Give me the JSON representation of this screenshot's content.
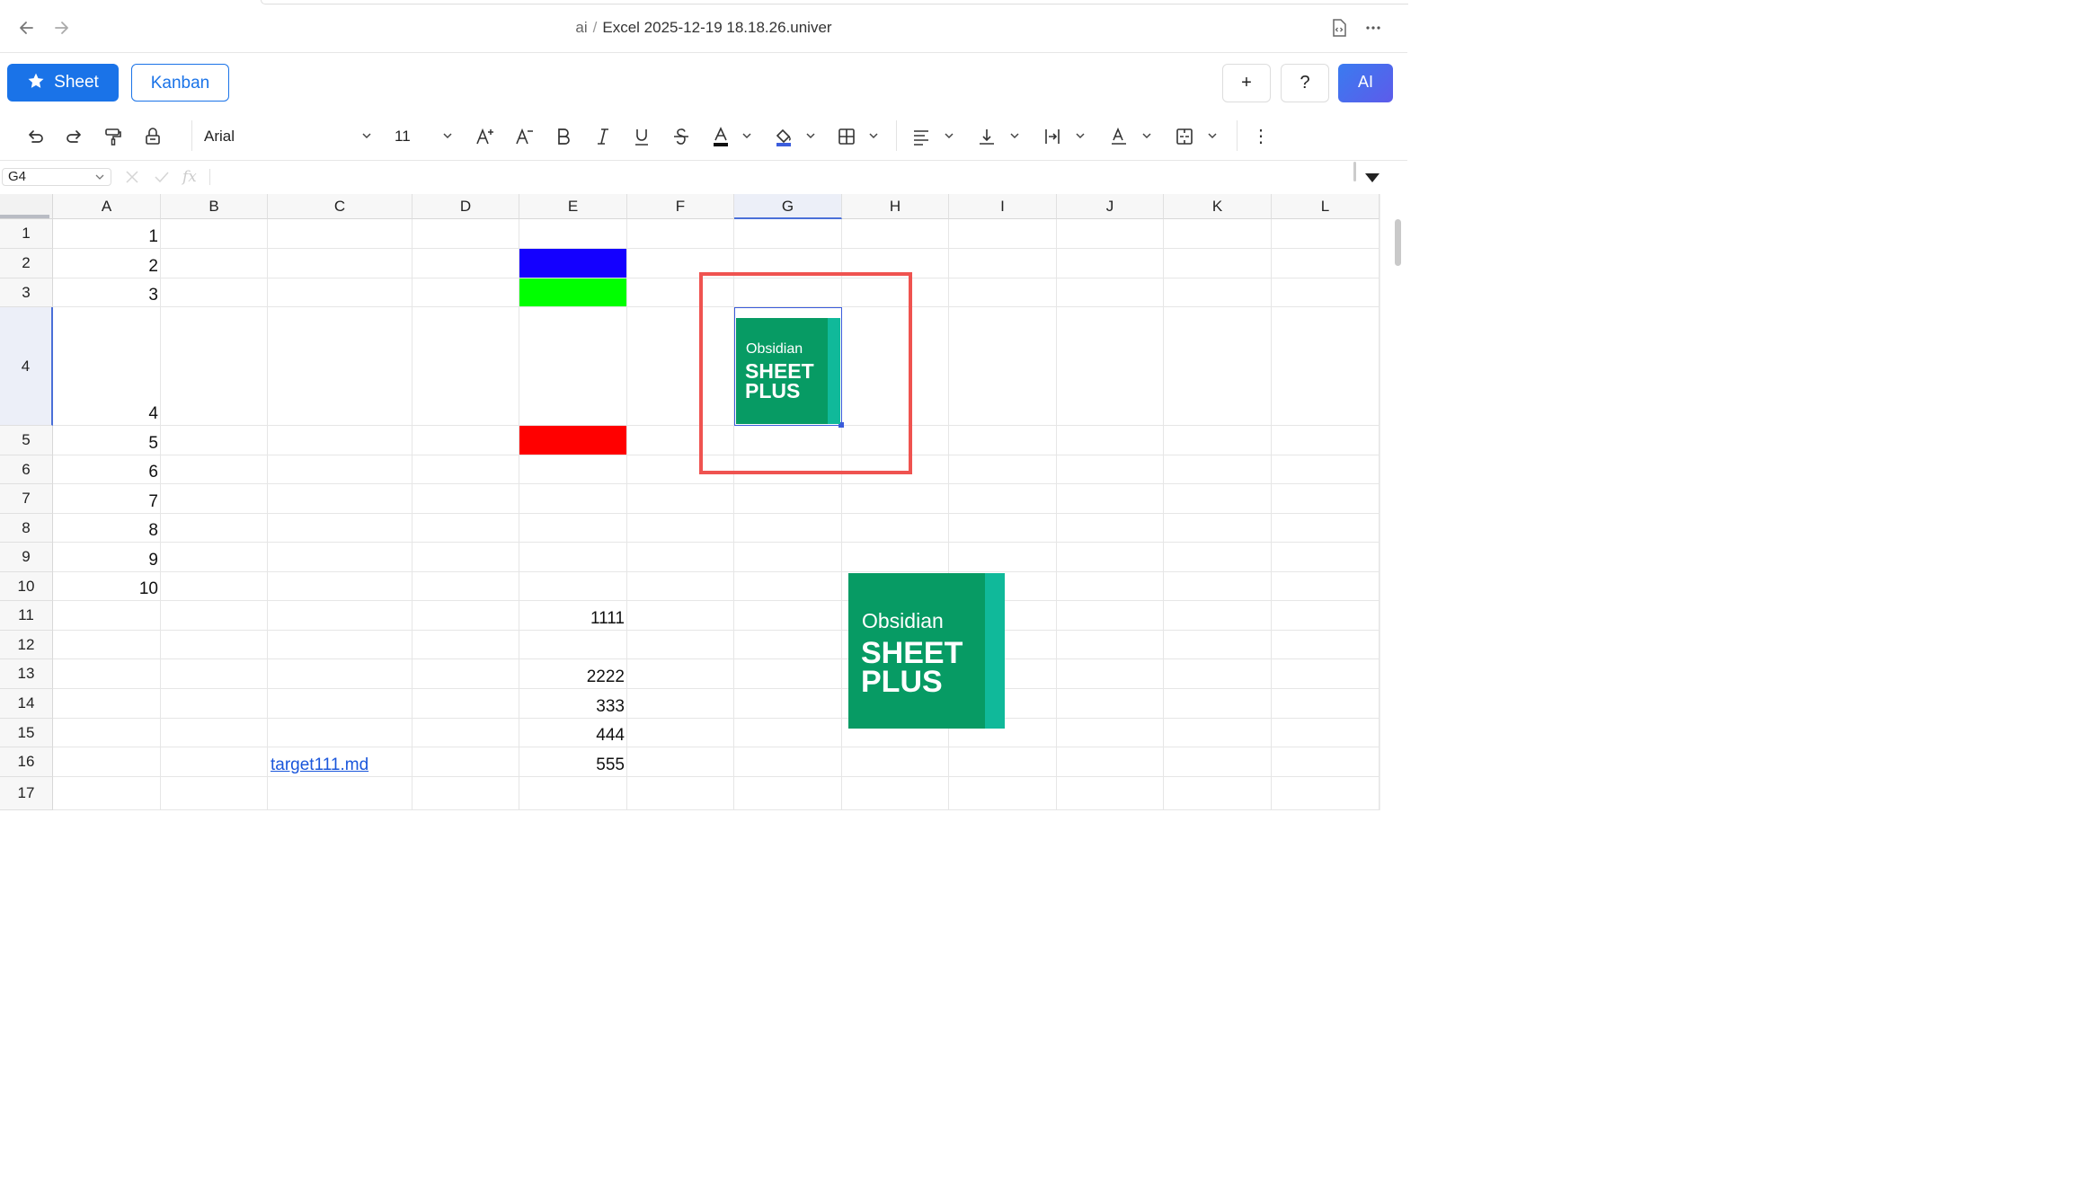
{
  "window": {
    "breadcrumb_parent": "ai",
    "breadcrumb_sep": "/",
    "title": "Excel 2025-12-19 18.18.26.univer"
  },
  "icons": {
    "back": "arrow-left-icon",
    "forward": "arrow-right-icon",
    "source": "code-file-icon",
    "more": "more-horizontal-icon"
  },
  "modes": {
    "sheet_label": "Sheet",
    "kanban_label": "Kanban"
  },
  "actions": {
    "add_label": "+",
    "help_label": "?",
    "ai_label": "AI"
  },
  "toolbar": {
    "font_name": "Arial",
    "font_size": "11",
    "more_label": "⋮"
  },
  "formula": {
    "cell_ref": "G4",
    "fx_label": "fx",
    "value": ""
  },
  "columns": [
    "A",
    "B",
    "C",
    "D",
    "E",
    "F",
    "G",
    "H",
    "I",
    "J",
    "K",
    "L"
  ],
  "selected_column": "G",
  "rows": [
    "1",
    "2",
    "3",
    "4",
    "5",
    "6",
    "7",
    "8",
    "9",
    "10",
    "11",
    "12",
    "13",
    "14",
    "15",
    "16",
    "17"
  ],
  "selected_row": "4",
  "cells": {
    "A1": "1",
    "A2": "2",
    "A3": "3",
    "A4": "4",
    "A5": "5",
    "A6": "6",
    "A7": "7",
    "A8": "8",
    "A9": "9",
    "A10": "10",
    "E11": "1111",
    "E13": "2222",
    "E14": "333",
    "E15": "444",
    "E16": "555",
    "C16": "target111.md"
  },
  "fills": {
    "E2": "#1400ff",
    "E3": "#00ff00",
    "E5": "#ff0000"
  },
  "images": {
    "logo_small": {
      "line1": "Obsidian",
      "line2": "SHEET",
      "line3": "PLUS"
    },
    "logo_large": {
      "line1": "Obsidian",
      "line2": "SHEET",
      "line3": "PLUS"
    }
  },
  "colors": {
    "accent": "#1a73e8",
    "highlight_box": "#ef5350",
    "logo_green": "#079b64",
    "logo_stripe": "#10b99a"
  }
}
